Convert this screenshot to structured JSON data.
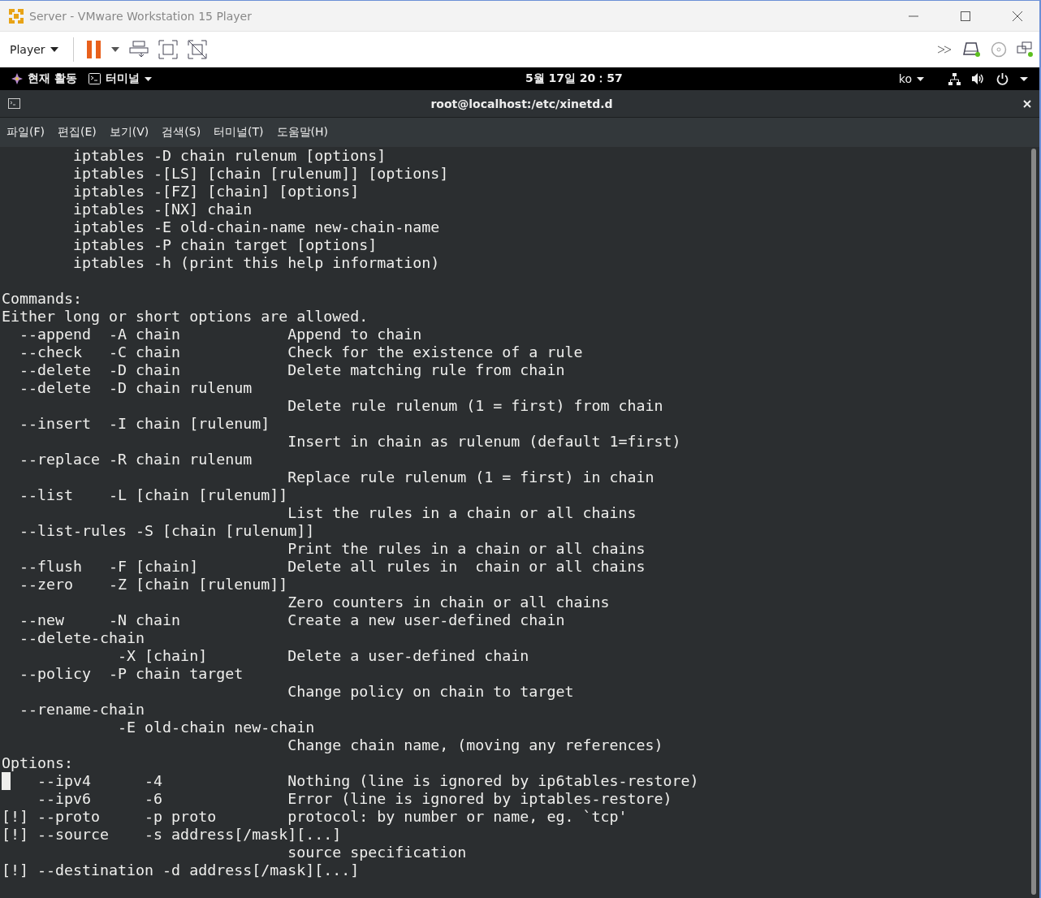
{
  "window": {
    "title": "Server - VMware Workstation 15 Player"
  },
  "toolbar": {
    "player_menu": "Player"
  },
  "top_bar": {
    "activities": "현재 활동",
    "app_menu": "터미널",
    "clock": "5월 17일  20：57",
    "input_method": "ko"
  },
  "terminal": {
    "title": "root@localhost:/etc/xinetd.d",
    "menu": [
      "파일(F)",
      "편집(E)",
      "보기(V)",
      "검색(S)",
      "터미널(T)",
      "도움말(H)"
    ],
    "lines": [
      {
        "text": "        iptables -D chain rulenum [options]",
        "cursor": false
      },
      {
        "text": "        iptables -[LS] [chain [rulenum]] [options]",
        "cursor": false
      },
      {
        "text": "        iptables -[FZ] [chain] [options]",
        "cursor": false
      },
      {
        "text": "        iptables -[NX] chain",
        "cursor": false
      },
      {
        "text": "        iptables -E old-chain-name new-chain-name",
        "cursor": false
      },
      {
        "text": "        iptables -P chain target [options]",
        "cursor": false
      },
      {
        "text": "        iptables -h (print this help information)",
        "cursor": false
      },
      {
        "cursor": false
      },
      {
        "text": "Commands:",
        "cursor": false
      },
      {
        "text": "Either long or short options are allowed.",
        "cursor": false
      },
      {
        "text": "  --append  -A chain            Append to chain",
        "cursor": false
      },
      {
        "text": "  --check   -C chain            Check for the existence of a rule",
        "cursor": false
      },
      {
        "text": "  --delete  -D chain            Delete matching rule from chain",
        "cursor": false
      },
      {
        "text": "  --delete  -D chain rulenum",
        "cursor": false
      },
      {
        "text": "                                Delete rule rulenum (1 = first) from chain",
        "cursor": false
      },
      {
        "text": "  --insert  -I chain [rulenum]",
        "cursor": false
      },
      {
        "text": "                                Insert in chain as rulenum (default 1=first)",
        "cursor": false
      },
      {
        "text": "  --replace -R chain rulenum",
        "cursor": false
      },
      {
        "text": "                                Replace rule rulenum (1 = first) in chain",
        "cursor": false
      },
      {
        "text": "  --list    -L [chain [rulenum]]",
        "cursor": false
      },
      {
        "text": "                                List the rules in a chain or all chains",
        "cursor": false
      },
      {
        "text": "  --list-rules -S [chain [rulenum]]",
        "cursor": false
      },
      {
        "text": "                                Print the rules in a chain or all chains",
        "cursor": false
      },
      {
        "text": "  --flush   -F [chain]          Delete all rules in  chain or all chains",
        "cursor": false
      },
      {
        "text": "  --zero    -Z [chain [rulenum]]",
        "cursor": false
      },
      {
        "text": "                                Zero counters in chain or all chains",
        "cursor": false
      },
      {
        "text": "  --new     -N chain            Create a new user-defined chain",
        "cursor": false
      },
      {
        "text": "  --delete-chain",
        "cursor": false
      },
      {
        "text": "             -X [chain]         Delete a user-defined chain",
        "cursor": false
      },
      {
        "text": "  --policy  -P chain target",
        "cursor": false
      },
      {
        "text": "                                Change policy on chain to target",
        "cursor": false
      },
      {
        "text": "  --rename-chain",
        "cursor": false
      },
      {
        "text": "             -E old-chain new-chain",
        "cursor": false
      },
      {
        "text": "                                Change chain name, (moving any references)",
        "cursor": false
      },
      {
        "text": "Options:",
        "cursor": false
      },
      {
        "text": "    --ipv4      -4              Nothing (line is ignored by ip6tables-restore)",
        "cursor": true
      },
      {
        "text": "    --ipv6      -6              Error (line is ignored by iptables-restore)",
        "cursor": false
      },
      {
        "text": "[!] --proto     -p proto        protocol: by number or name, eg. `tcp'",
        "cursor": false
      },
      {
        "text": "[!] --source    -s address[/mask][...]",
        "cursor": false
      },
      {
        "text": "                                source specification",
        "cursor": false
      },
      {
        "text": "[!] --destination -d address[/mask][...]",
        "cursor": false
      }
    ]
  }
}
